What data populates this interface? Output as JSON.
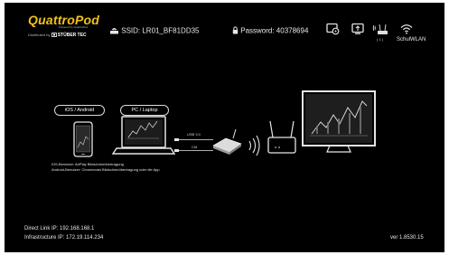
{
  "header": {
    "logo_text": "QuattroPod",
    "logo_subtext": "Powered by QuattroPod",
    "powered_prefix": "Distributed by",
    "powered_brand": "STÜBER TEC",
    "ssid": "SSID: LR01_BF81DD35",
    "password": "Password: 40378694",
    "wlan_label": "SchulWLAN",
    "client_count": "( 1 )",
    "icons": [
      "wifi-router-icon",
      "lock-icon",
      "settings-icon",
      "screen-mirror-icon",
      "router-signal-icon",
      "wifi-icon"
    ]
  },
  "diagram": {
    "ios_android_label": "iOS / Android",
    "pc_laptop_label": "PC / Laptop",
    "usb_label": "USB 3.0",
    "cm_label": "CM",
    "notes": [
      "iOS-Benutzer: AirPlay Bildschirmübertragung",
      "Android-Benutzer: Chromecast Bildschirmübertragung oder die App"
    ]
  },
  "footer": {
    "direct_link": "Direct Link IP: 192.168.168.1",
    "infrastructure": "Infrastructure IP: 172.19.114.234",
    "version": "ver 1.8530.15"
  },
  "colors": {
    "background": "#000000",
    "logo": "#f3c21b",
    "text": "#e6e6e6"
  }
}
